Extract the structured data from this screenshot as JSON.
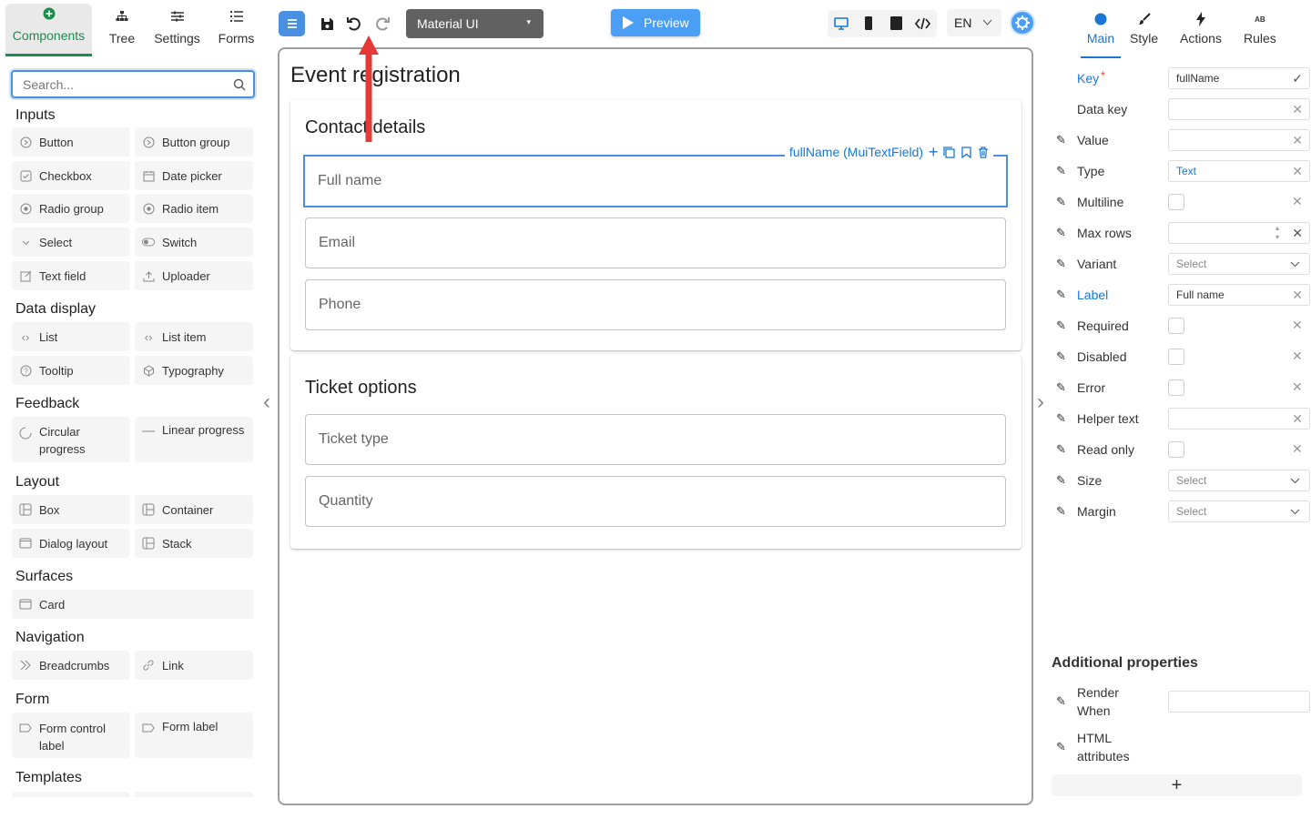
{
  "left_tabs": [
    {
      "label": "Components",
      "icon": "plus-circle-icon"
    },
    {
      "label": "Tree",
      "icon": "tree-icon"
    },
    {
      "label": "Settings",
      "icon": "sliders-icon"
    },
    {
      "label": "Forms",
      "icon": "list-icon"
    }
  ],
  "search": {
    "placeholder": "Search..."
  },
  "categories": {
    "inputs": "Inputs",
    "data_display": "Data display",
    "feedback": "Feedback",
    "layout": "Layout",
    "surfaces": "Surfaces",
    "navigation": "Navigation",
    "form": "Form",
    "templates": "Templates"
  },
  "components": {
    "button": "Button",
    "button_group": "Button group",
    "checkbox": "Checkbox",
    "date_picker": "Date picker",
    "radio_group": "Radio group",
    "radio_item": "Radio item",
    "select": "Select",
    "switch": "Switch",
    "text_field": "Text field",
    "uploader": "Uploader",
    "list": "List",
    "list_item": "List item",
    "tooltip": "Tooltip",
    "typography": "Typography",
    "circular_progress_1": "Circular",
    "circular_progress_2": "progress",
    "linear_progress": "Linear progress",
    "box": "Box",
    "container": "Container",
    "dialog_layout": "Dialog layout",
    "stack": "Stack",
    "card": "Card",
    "breadcrumbs": "Breadcrumbs",
    "link": "Link",
    "form_control_label_1": "Form control",
    "form_control_label_2": "label",
    "form_label": "Form label"
  },
  "toolbar": {
    "ui_library": "Material UI",
    "preview": "Preview",
    "language": "EN"
  },
  "canvas": {
    "title": "Event registration",
    "section1": "Contact details",
    "section2": "Ticket options",
    "selected_label": "fullName (MuiTextField)",
    "fields": [
      "Full name",
      "Email",
      "Phone",
      "Ticket type",
      "Quantity"
    ]
  },
  "right_tabs": [
    {
      "label": "Main",
      "icon": "circle-icon"
    },
    {
      "label": "Style",
      "icon": "brush-icon"
    },
    {
      "label": "Actions",
      "icon": "lightning-icon"
    },
    {
      "label": "Rules",
      "icon": "rules-icon"
    }
  ],
  "props": {
    "key": "Key",
    "key_required": "*",
    "key_value": "fullName",
    "data_key": "Data key",
    "value": "Value",
    "type": "Type",
    "type_value": "Text",
    "multiline": "Multiline",
    "max_rows": "Max rows",
    "variant": "Variant",
    "variant_value": "Select",
    "label": "Label",
    "label_value": "Full name",
    "required": "Required",
    "disabled": "Disabled",
    "error": "Error",
    "helper_text": "Helper text",
    "read_only": "Read only",
    "size": "Size",
    "size_value": "Select",
    "margin": "Margin",
    "margin_value": "Select"
  },
  "additional": {
    "title": "Additional properties",
    "render_when_1": "Render",
    "render_when_2": "When",
    "html_attr_1": "HTML",
    "html_attr_2": "attributes",
    "add": "+"
  },
  "colors": {
    "accent": "#1976d2",
    "green": "#1a8d4a",
    "arrow": "#e53935",
    "preview": "#4a9ff5"
  }
}
